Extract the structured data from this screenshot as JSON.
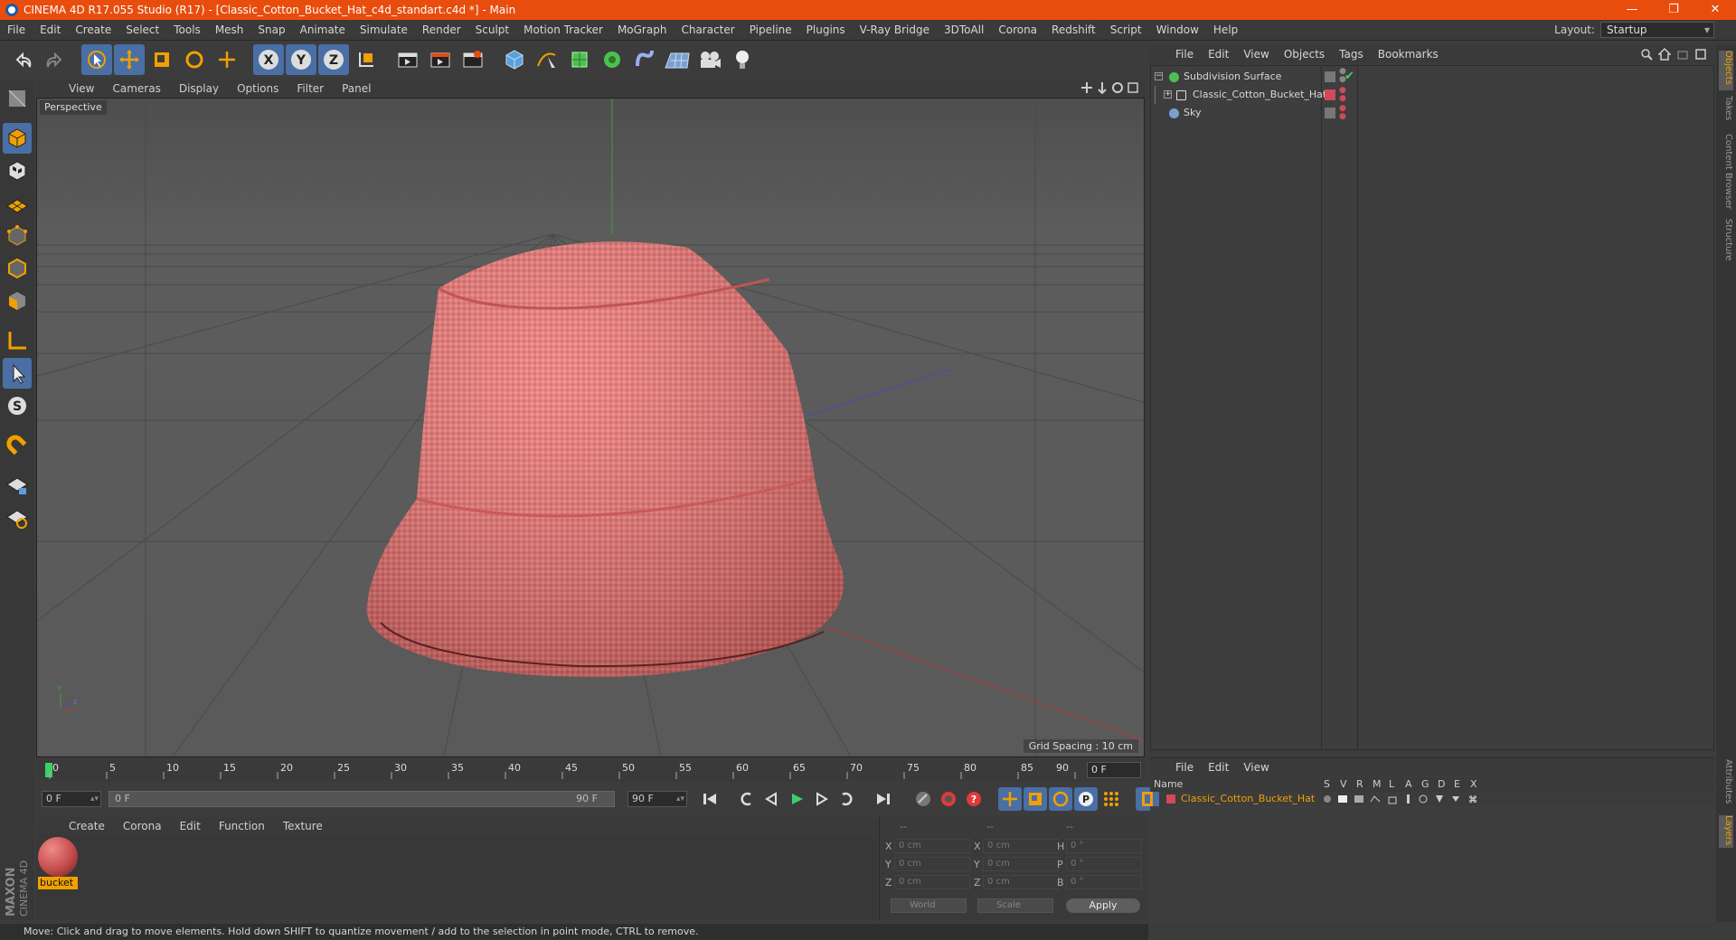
{
  "window": {
    "title": "CINEMA 4D R17.055 Studio (R17) - [Classic_Cotton_Bucket_Hat_c4d_standart.c4d *] - Main",
    "minimize": "—",
    "restore": "❐",
    "close": "✕"
  },
  "menubar": {
    "items": [
      "File",
      "Edit",
      "Create",
      "Select",
      "Tools",
      "Mesh",
      "Snap",
      "Animate",
      "Simulate",
      "Render",
      "Sculpt",
      "Motion Tracker",
      "MoGraph",
      "Character",
      "Pipeline",
      "Plugins",
      "V-Ray Bridge",
      "3DToAll",
      "Corona",
      "Redshift",
      "Script",
      "Window",
      "Help"
    ],
    "layout_label": "Layout:",
    "layout_value": "Startup"
  },
  "viewport": {
    "menu": [
      "View",
      "Cameras",
      "Display",
      "Options",
      "Filter",
      "Panel"
    ],
    "camera_label": "Perspective",
    "grid_spacing": "Grid Spacing : 10 cm"
  },
  "timeline": {
    "ticks": [
      "0",
      "5",
      "10",
      "15",
      "20",
      "25",
      "30",
      "35",
      "40",
      "45",
      "50",
      "55",
      "60",
      "65",
      "70",
      "75",
      "80",
      "85",
      "90"
    ],
    "current_frame": "0 F",
    "start_field": "0 F",
    "slider_start": "0 F",
    "slider_end": "90 F",
    "end_field": "90 F"
  },
  "material_manager": {
    "menu": [
      "Create",
      "Corona",
      "Edit",
      "Function",
      "Texture"
    ],
    "materials": [
      {
        "name": "bucket"
      }
    ]
  },
  "coordinates": {
    "headers": [
      "--",
      "--",
      "--"
    ],
    "rows": [
      {
        "l1": "X",
        "v1": "0 cm",
        "l2": "X",
        "v2": "0 cm",
        "l3": "H",
        "v3": "0 °"
      },
      {
        "l1": "Y",
        "v1": "0 cm",
        "l2": "Y",
        "v2": "0 cm",
        "l3": "P",
        "v3": "0 °"
      },
      {
        "l1": "Z",
        "v1": "0 cm",
        "l2": "Z",
        "v2": "0 cm",
        "l3": "B",
        "v3": "0 °"
      }
    ],
    "mode": "World",
    "scale": "Scale",
    "apply": "Apply"
  },
  "status": "Move: Click and drag to move elements. Hold down SHIFT to quantize movement / add to the selection in point mode, CTRL to remove.",
  "brand": {
    "maxon": "MAXON",
    "c4d": "CINEMA 4D"
  },
  "object_manager": {
    "menu": [
      "File",
      "Edit",
      "View",
      "Objects",
      "Tags",
      "Bookmarks"
    ],
    "objects": [
      {
        "name": "Subdivision Surface",
        "color": "#4fc04f"
      },
      {
        "name": "Classic_Cotton_Bucket_Hat",
        "color": "#d24a5a"
      },
      {
        "name": "Sky",
        "color": "#7aa0d0"
      }
    ]
  },
  "right_tabs": [
    "Objects",
    "Takes",
    "Content Browser",
    "Structure",
    "Attributes",
    "Layers"
  ],
  "layer_manager": {
    "menu": [
      "File",
      "Edit",
      "View"
    ],
    "columns": [
      "Name",
      "S",
      "V",
      "R",
      "M",
      "L",
      "A",
      "G",
      "D",
      "E",
      "X"
    ],
    "layers": [
      {
        "name": "Classic_Cotton_Bucket_Hat",
        "color": "#d24a5a"
      }
    ]
  },
  "colors": {
    "accent": "#e84d0e",
    "selection": "#f0a000",
    "tool_active": "#4a6fa5"
  }
}
